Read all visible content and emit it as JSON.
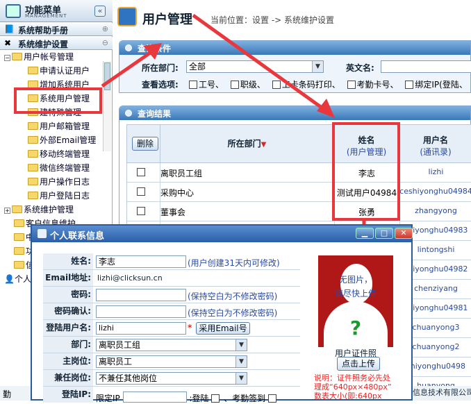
{
  "sidebar": {
    "title": "功能菜单",
    "subtitle": "MANAGEMENT",
    "collapse_icon": "«",
    "sections": [
      {
        "label": "系统帮助手册",
        "control": "⊕"
      },
      {
        "label": "系统维护设置",
        "control": "⊖"
      }
    ],
    "tree": {
      "root": "用户帐号管理",
      "items": [
        "申请认证用户",
        "增加系统用户",
        "系统用户管理",
        "建特殊管理",
        "用户邮箱管理",
        "外部Email管理",
        "移动终端管理",
        "微信终端管理",
        "用户操作日志",
        "用户登陆日志"
      ],
      "siblings": [
        "系统维护管理",
        "客户信息维护",
        "中",
        "功",
        "信",
        "个人"
      ]
    },
    "footer_label": "勤"
  },
  "page": {
    "title": "用户管理",
    "breadcrumb": "当前位置：设置 -> 系统维护设置"
  },
  "query": {
    "title": "查询条件",
    "dept_label": "所在部门:",
    "dept_value": "全部",
    "en_name_label": "英文名:",
    "options_label": "查看选项:",
    "options": [
      "工号、",
      "职级、",
      "工卡条码打印、",
      "考勤卡号、",
      "绑定IP(登陆、"
    ]
  },
  "results": {
    "title": "查询结果",
    "delete_button": "删除",
    "col_dept": "所在部门",
    "col_name": "姓名",
    "col_name_sub": "(用户管理)",
    "col_user": "用户名",
    "col_user_sub": "(通讯录)",
    "sort_icon": "▼",
    "rows": [
      {
        "dept": "离职员工组",
        "name": "李志",
        "user": "lizhi"
      },
      {
        "dept": "采购中心",
        "name": "测试用户04984",
        "user": "ceshiyonghu04984"
      },
      {
        "dept": "董事会",
        "name": "张勇",
        "user": "zhangyong"
      },
      {
        "dept": "",
        "name": "",
        "user": "shiyonghu04983"
      },
      {
        "dept": "",
        "name": "",
        "user": "lintongshi"
      },
      {
        "dept": "",
        "name": "",
        "user": "shiyonghu04982"
      },
      {
        "dept": "",
        "name": "",
        "user": "chenziyang"
      },
      {
        "dept": "",
        "name": "",
        "user": "shiyonghu04981"
      },
      {
        "dept": "",
        "name": "",
        "user": "chuanyong3"
      },
      {
        "dept": "",
        "name": "",
        "user": "chuanyong2"
      },
      {
        "dept": "",
        "name": "",
        "user": "shiyonghu0498"
      },
      {
        "dept": "",
        "name": "",
        "user": "huanyong"
      }
    ]
  },
  "dialog": {
    "title": "个人联系信息",
    "btn_min": "▁",
    "btn_max": "□",
    "btn_close": "✕",
    "name_label": "姓名:",
    "name_value": "李志",
    "name_hint": "(用户创建31天内可修改)",
    "email_label": "Email地址:",
    "email_value": "lizhi@clicksun.cn",
    "pwd_label": "密码:",
    "pwd_hint": "(保持空白为不修改密码)",
    "pwd2_label": "密码确认:",
    "pwd2_hint": "(保持空白为不修改密码)",
    "login_label": "登陆用户名:",
    "login_value": "lizhi",
    "required_mark": "*",
    "use_email_button": "采用Email号",
    "dept_label": "部门:",
    "dept_value": "离职员工组",
    "post_label": "主岗位:",
    "post_value": "离职员工",
    "part_label": "兼任岗位:",
    "part_value": "不兼任其他岗位",
    "ip_label": "登陆IP:",
    "ip_prefix": "限定IP",
    "ip_login": ":登陆",
    "ip_attend": "、考勤签到",
    "photo_text1": "无图片，",
    "photo_text2": "请尽快上传",
    "photo_mark": "?",
    "photo_caption": "用户证件照",
    "upload_button": "点击上传",
    "note1": "说明：证件照务必先处",
    "note2": "理成“640px×480px”",
    "note3": "数表大小(即:640px"
  },
  "status": {
    "right": "信息技术有限公司"
  },
  "colors": {
    "highlight": "#e8383d",
    "accent": "#2a5ea8"
  }
}
